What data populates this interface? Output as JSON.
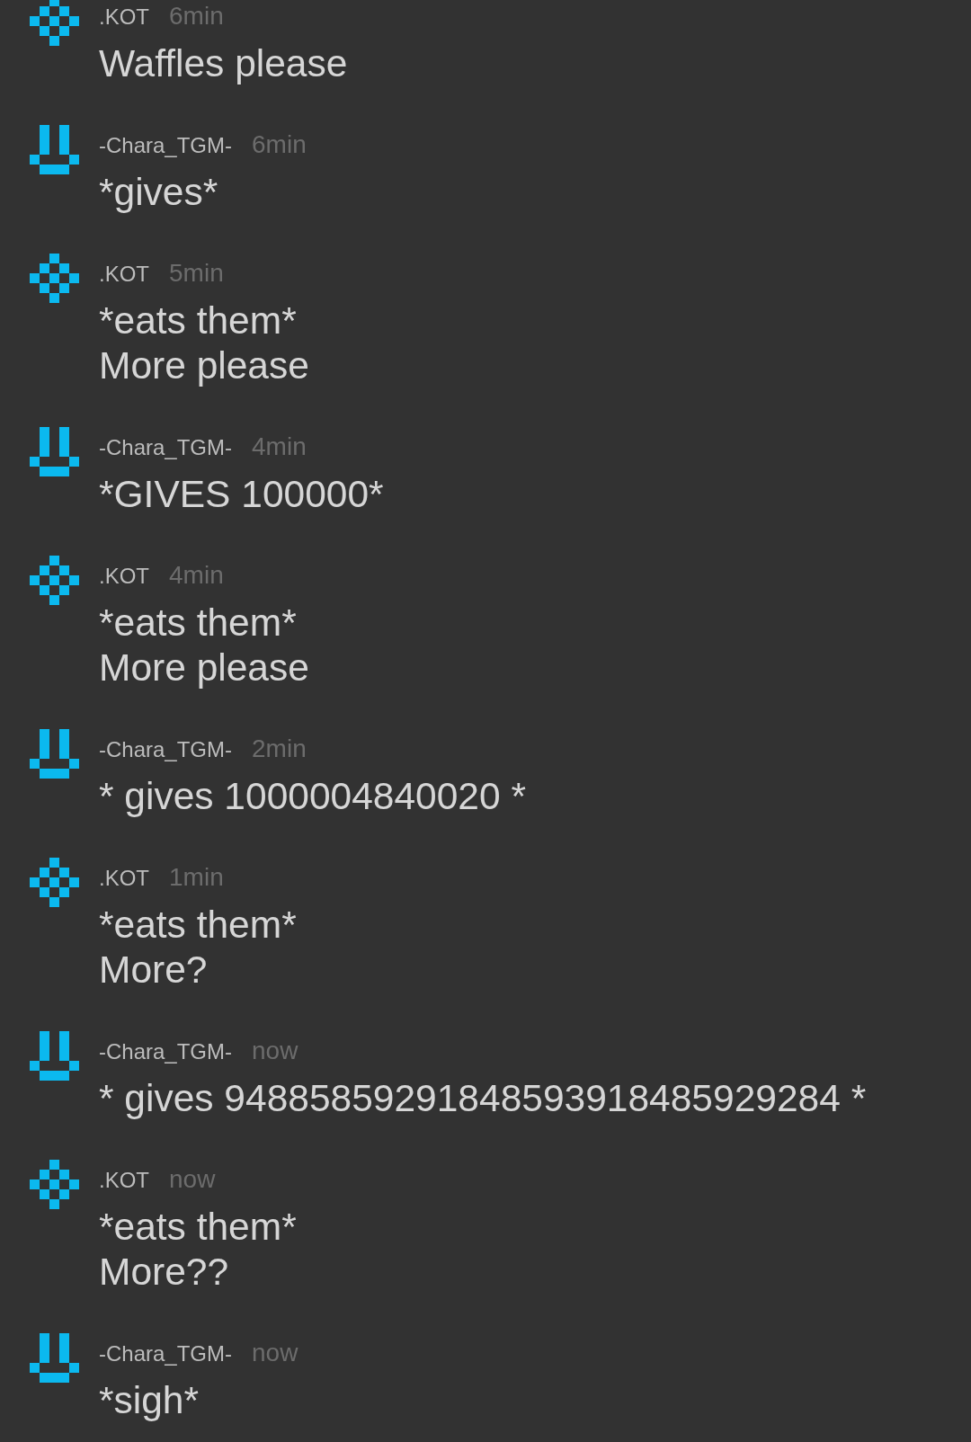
{
  "messages": [
    {
      "author": ".KOT",
      "avatar": {
        "kind": "diamond"
      },
      "time": "6min",
      "lines": [
        "Waffles please"
      ]
    },
    {
      "author": "-Chara_TGM-",
      "avatar": {
        "kind": "smile"
      },
      "time": "6min",
      "lines": [
        "*gives*"
      ]
    },
    {
      "author": ".KOT",
      "avatar": {
        "kind": "diamond"
      },
      "time": "5min",
      "lines": [
        "*eats them*",
        "More please"
      ]
    },
    {
      "author": "-Chara_TGM-",
      "avatar": {
        "kind": "smile"
      },
      "time": "4min",
      "lines": [
        "*GIVES 100000*"
      ]
    },
    {
      "author": ".KOT",
      "avatar": {
        "kind": "diamond"
      },
      "time": "4min",
      "lines": [
        "*eats them*",
        "More please"
      ]
    },
    {
      "author": "-Chara_TGM-",
      "avatar": {
        "kind": "smile"
      },
      "time": "2min",
      "lines": [
        "* gives 1000004840020 *"
      ]
    },
    {
      "author": ".KOT",
      "avatar": {
        "kind": "diamond"
      },
      "time": "1min",
      "lines": [
        "*eats them*",
        "More?"
      ]
    },
    {
      "author": "-Chara_TGM-",
      "avatar": {
        "kind": "smile"
      },
      "time": "now",
      "lines": [
        "* gives 94885859291848593918485929284 *"
      ]
    },
    {
      "author": ".KOT",
      "avatar": {
        "kind": "diamond"
      },
      "time": "now",
      "lines": [
        "*eats them*",
        "More??"
      ]
    },
    {
      "author": "-Chara_TGM-",
      "avatar": {
        "kind": "smile"
      },
      "time": "now",
      "lines": [
        "*sigh*"
      ]
    }
  ]
}
